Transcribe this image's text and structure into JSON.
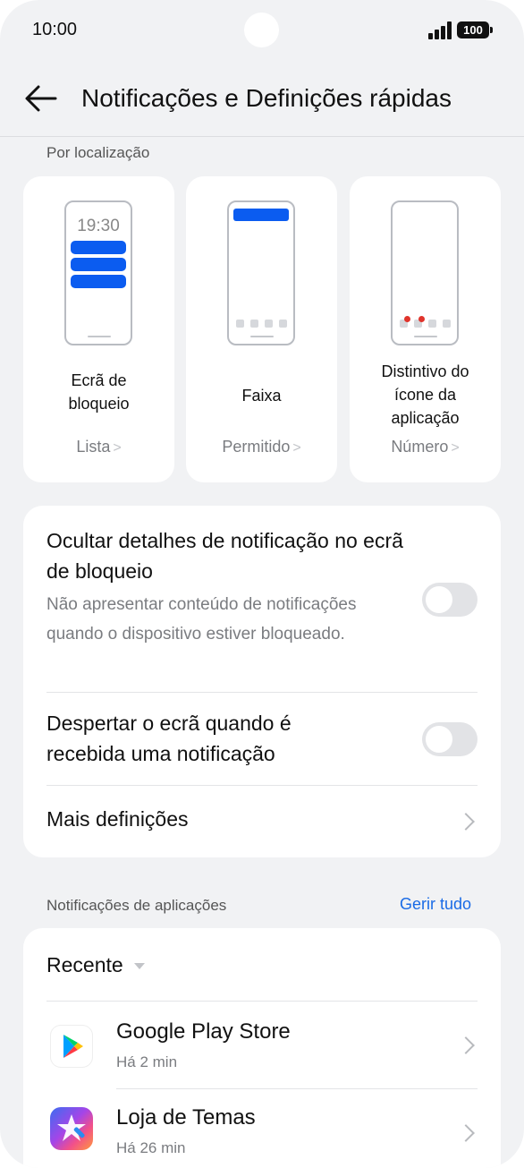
{
  "status_bar": {
    "time": "10:00",
    "battery": "100"
  },
  "header": {
    "title": "Notificações e Definições rápidas"
  },
  "location_section": {
    "label": "Por localização",
    "cards": [
      {
        "title": "Ecrã de bloqueio",
        "value": "Lista",
        "preview_clock": "19:30"
      },
      {
        "title": "Faixa",
        "value": "Permitido"
      },
      {
        "title": "Distintivo do ícone da aplicação",
        "value": "Número"
      }
    ]
  },
  "settings": {
    "hide_details": {
      "title": "Ocultar detalhes de notificação no ecrã de bloqueio",
      "subtitle": "Não apresentar conteúdo de notificações quando o dispositivo estiver bloqueado.",
      "enabled": false
    },
    "wake_screen": {
      "title": "Despertar o ecrã quando é recebida uma notificação",
      "enabled": false
    },
    "more": {
      "title": "Mais definições"
    }
  },
  "app_notifications": {
    "label": "Notificações de aplicações",
    "manage_all": "Gerir tudo",
    "filter": "Recente",
    "apps": [
      {
        "name": "Google Play Store",
        "time": "Há 2 min",
        "icon": "google-play-icon"
      },
      {
        "name": "Loja de Temas",
        "time": "Há 26 min",
        "icon": "theme-store-icon"
      }
    ]
  },
  "colors": {
    "accent": "#1a6be6",
    "preview_blue": "#0b5cf0",
    "background": "#f1f2f4",
    "badge_red": "#e0342c"
  }
}
